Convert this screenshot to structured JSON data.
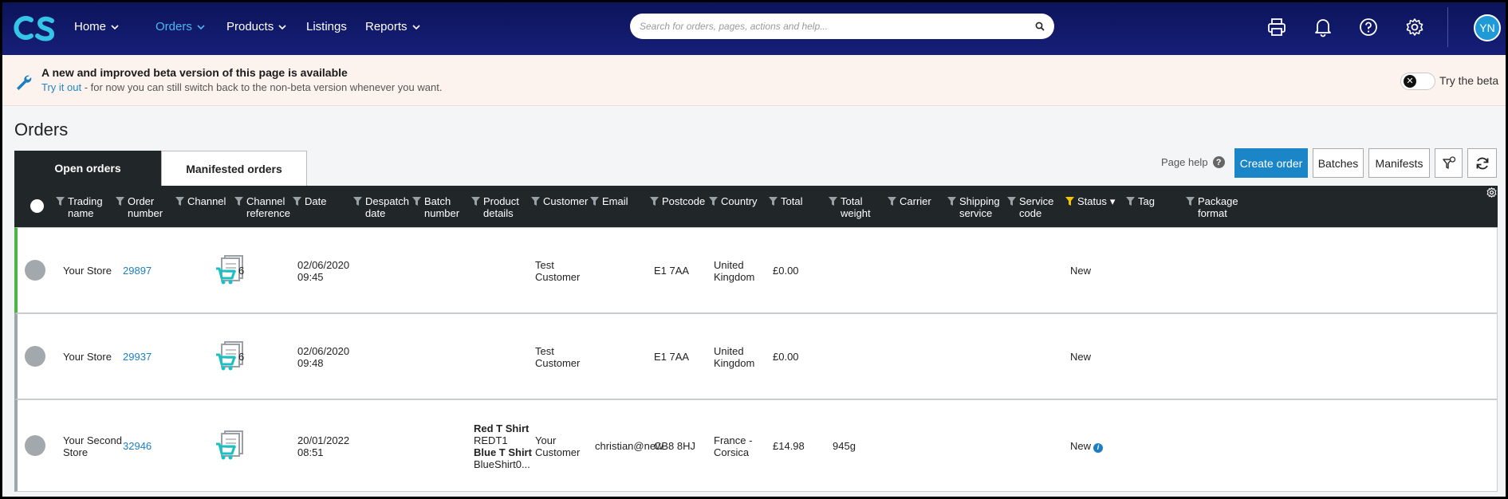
{
  "nav": {
    "logo_text": "CS",
    "items": [
      {
        "label": "Home",
        "dropdown": true,
        "active": false
      },
      {
        "label": "Orders",
        "dropdown": true,
        "active": true
      },
      {
        "label": "Products",
        "dropdown": true,
        "active": false
      },
      {
        "label": "Listings",
        "dropdown": false,
        "active": false
      },
      {
        "label": "Reports",
        "dropdown": true,
        "active": false
      }
    ],
    "search_placeholder": "Search for orders, pages, actions and help...",
    "icons": [
      "printer-icon",
      "bell-icon",
      "help-circle-icon",
      "gear-icon"
    ],
    "avatar_initials": "YN"
  },
  "banner": {
    "title": "A new and improved beta version of this page is available",
    "link_text": "Try it out",
    "subtitle_rest": " - for now you can still switch back to the non-beta version whenever you want.",
    "toggle_label": "Try the beta",
    "toggle_on": false
  },
  "page": {
    "title": "Orders",
    "tabs": [
      {
        "label": "Open orders",
        "active": true
      },
      {
        "label": "Manifested orders",
        "active": false
      }
    ],
    "page_help": "Page help",
    "buttons": {
      "create_order": "Create order",
      "batches": "Batches",
      "manifests": "Manifests"
    }
  },
  "table": {
    "columns": [
      {
        "label": "Trading\nname",
        "filter": true
      },
      {
        "label": "Order\nnumber",
        "filter": true
      },
      {
        "label": "Channel",
        "filter": true
      },
      {
        "label": "Channel\nreference",
        "filter": true
      },
      {
        "label": "Date",
        "filter": true
      },
      {
        "label": "Despatch\ndate",
        "filter": true
      },
      {
        "label": "Batch\nnumber",
        "filter": true
      },
      {
        "label": "Product\ndetails",
        "filter": true
      },
      {
        "label": "Customer",
        "filter": true
      },
      {
        "label": "Email",
        "filter": true
      },
      {
        "label": "Postcode",
        "filter": true
      },
      {
        "label": "Country",
        "filter": true
      },
      {
        "label": "Total",
        "filter": true
      },
      {
        "label": "Total\nweight",
        "filter": true
      },
      {
        "label": "Carrier",
        "filter": true
      },
      {
        "label": "Shipping\nservice",
        "filter": true
      },
      {
        "label": "Service\ncode",
        "filter": true
      },
      {
        "label": "Status",
        "filter": true,
        "filter_active": true,
        "sorted": true
      },
      {
        "label": "Tag",
        "filter": true
      },
      {
        "label": "Package\nformat",
        "filter": true
      }
    ],
    "rows": [
      {
        "trading_name": "Your Store",
        "order_number": "29897",
        "channel_icon": "shopping-cart-document-icon",
        "channel_reference": "6",
        "date": "02/06/2020\n09:45",
        "products": [],
        "customer": "Test\nCustomer",
        "email": "",
        "postcode": "E1 7AA",
        "country": "United\nKingdom",
        "total": "£0.00",
        "total_weight": "",
        "status": "New",
        "status_info": false,
        "highlight": true
      },
      {
        "trading_name": "Your Store",
        "order_number": "29937",
        "channel_icon": "shopping-cart-document-icon",
        "channel_reference": "6",
        "date": "02/06/2020\n09:48",
        "products": [],
        "customer": "Test\nCustomer",
        "email": "",
        "postcode": "E1 7AA",
        "country": "United\nKingdom",
        "total": "£0.00",
        "total_weight": "",
        "status": "New",
        "status_info": false,
        "highlight": false
      },
      {
        "trading_name": "Your Second\nStore",
        "order_number": "32946",
        "channel_icon": "shopping-cart-document-icon",
        "channel_reference": "",
        "date": "20/01/2022\n08:51",
        "products": [
          {
            "name": "Red T Shirt",
            "sku": "REDT1"
          },
          {
            "name": "Blue T Shirt",
            "sku": "BlueShirt0..."
          }
        ],
        "customer": "Your\nCustomer",
        "email": "christian@new",
        "postcode": "CB8 8HJ",
        "country": "France -\nCorsica",
        "total": "£14.98",
        "total_weight": "945g",
        "status": "New",
        "status_info": true,
        "highlight": false
      }
    ]
  },
  "colors": {
    "nav_bg": "#0c145a",
    "accent_blue": "#1b86c7",
    "active_nav": "#4db8f0",
    "header_bg": "#212729",
    "row_active_border": "#4cb444",
    "filter_active": "#f5c400"
  }
}
